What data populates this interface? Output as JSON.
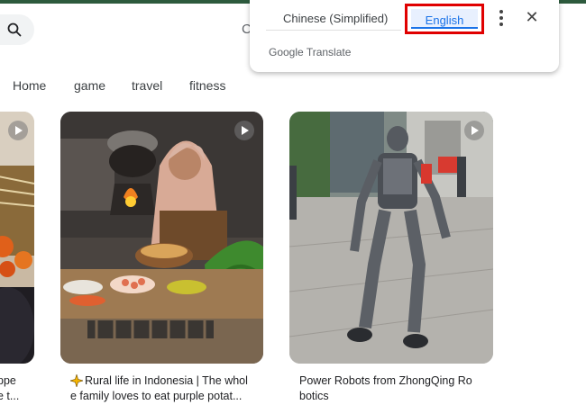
{
  "search": {
    "icon": "search-icon"
  },
  "header": {
    "partial_glyph": "C"
  },
  "tabs": [
    {
      "label": "Home"
    },
    {
      "label": "game"
    },
    {
      "label": "travel"
    },
    {
      "label": "fitness"
    }
  ],
  "cards": [
    {
      "caption_lines": [
        "ppe",
        "e t..."
      ]
    },
    {
      "caption_lines": [
        "Rural life in Indonesia | The whol",
        "e family loves to eat purple potat..."
      ],
      "badge_icon": "sparkle-icon"
    },
    {
      "caption_lines": [
        "Power Robots from ZhongQing Ro",
        "botics"
      ]
    }
  ],
  "translate_popup": {
    "source_language": "Chinese (Simplified)",
    "target_language": "English",
    "branding": "Google Translate",
    "menu_icon": "more-vert-icon",
    "close_icon": "close-icon"
  },
  "colors": {
    "top_strip": "#2d5a3d",
    "highlight": "#e00000",
    "accent": "#1a73e8"
  }
}
